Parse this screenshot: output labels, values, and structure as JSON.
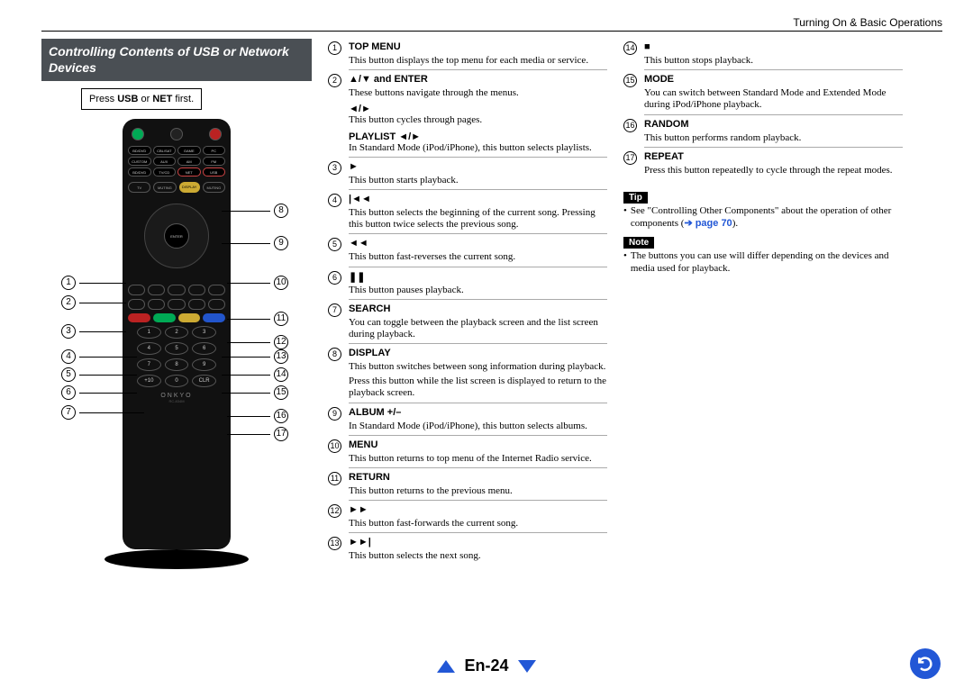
{
  "header": {
    "section": "Turning On & Basic Operations"
  },
  "section_title": "Controlling Contents of USB or Network Devices",
  "press_box": {
    "pre": "Press ",
    "b1": "USB",
    "mid": " or ",
    "b2": "NET",
    "post": " first."
  },
  "remote": {
    "devices": [
      "BD/DVD",
      "CBL/SAT",
      "GAME",
      "PC",
      "CUSTOM",
      "AUX",
      "AM",
      "FM",
      "BD/DVD",
      "TV/CD",
      "NET",
      "USB"
    ],
    "row_btns": [
      "TV",
      "MUTING",
      "DISPLAY",
      "MUTING"
    ],
    "enter": "ENTER",
    "numbers": [
      "1",
      "2",
      "3",
      "4",
      "5",
      "6",
      "7",
      "8",
      "9",
      "+10",
      "0",
      "CLR"
    ],
    "brand": "ONKYO",
    "model": "RC-834M"
  },
  "callouts_left": [
    1,
    2,
    3,
    4,
    5,
    6,
    7
  ],
  "callouts_right": [
    8,
    9,
    10,
    11,
    12,
    13,
    14,
    15,
    16,
    17
  ],
  "col2": [
    {
      "n": 1,
      "title": "TOP MENU",
      "body": "This button displays the top menu for each media or service."
    },
    {
      "n": 2,
      "title": "▲/▼ and ENTER",
      "body": "These buttons navigate through the menus.",
      "sub": "◄/►",
      "body2": "This button cycles through pages.",
      "sub2": "PLAYLIST ◄/►",
      "body3": "In Standard Mode (iPod/iPhone), this button selects playlists."
    },
    {
      "n": 3,
      "title": "►",
      "body": "This button starts playback."
    },
    {
      "n": 4,
      "title": "|◄◄",
      "body": "This button selects the beginning of the current song. Pressing this button twice selects the previous song."
    },
    {
      "n": 5,
      "title": "◄◄",
      "body": "This button fast-reverses the current song."
    },
    {
      "n": 6,
      "title": "❚❚",
      "body": "This button pauses playback."
    },
    {
      "n": 7,
      "title": "SEARCH",
      "body": "You can toggle between the playback screen and the list screen during playback."
    },
    {
      "n": 8,
      "title": "DISPLAY",
      "body": "This button switches between song information during playback.",
      "body2": "Press this button while the list screen is displayed to return to the playback screen."
    },
    {
      "n": 9,
      "title": "ALBUM +/–",
      "body": "In Standard Mode (iPod/iPhone), this button selects albums."
    },
    {
      "n": 10,
      "title": "MENU",
      "body": "This button returns to top menu of the Internet Radio service."
    },
    {
      "n": 11,
      "title": "RETURN",
      "body": "This button returns to the previous menu."
    },
    {
      "n": 12,
      "title": "►►",
      "body": "This button fast-forwards the current song."
    },
    {
      "n": 13,
      "title": "►►|",
      "body": "This button selects the next song."
    }
  ],
  "col3": [
    {
      "n": 14,
      "title": "■",
      "body": "This button stops playback."
    },
    {
      "n": 15,
      "title": "MODE",
      "body": "You can switch between Standard Mode and Extended Mode during iPod/iPhone playback."
    },
    {
      "n": 16,
      "title": "RANDOM",
      "body": "This button performs random playback."
    },
    {
      "n": 17,
      "title": "REPEAT",
      "body": "Press this button repeatedly to cycle through the repeat modes."
    }
  ],
  "tip": {
    "label": "Tip",
    "text_pre": "See \"Controlling Other Components\" about the operation of other components (",
    "link": "➔ page 70",
    "text_post": ")."
  },
  "note": {
    "label": "Note",
    "text": "The buttons you can use will differ depending on the devices and media used for playback."
  },
  "footer": {
    "page": "En-24"
  }
}
